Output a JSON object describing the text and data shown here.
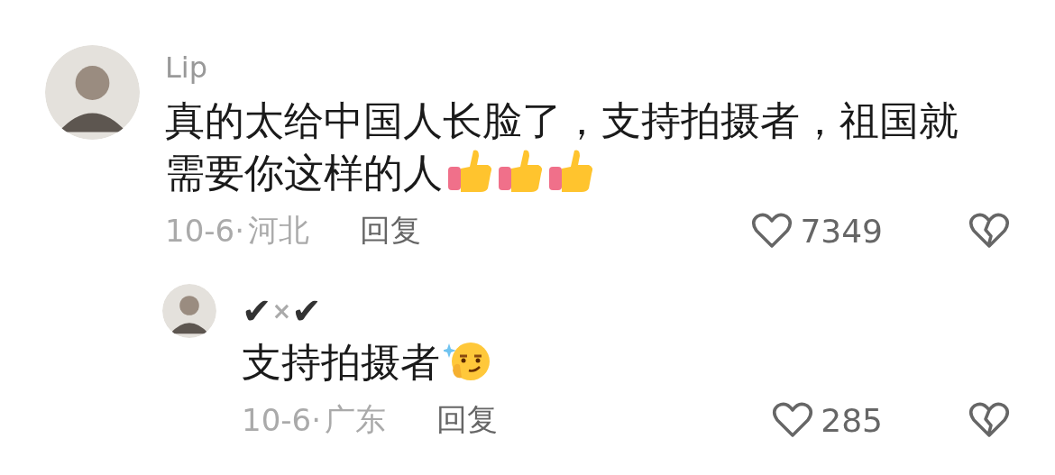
{
  "comments": [
    {
      "author_parts": [
        {
          "text": "Lip",
          "muted": false
        }
      ],
      "text_lines": [
        "真的太给中国人长脸了，支持拍摄者，祖国就",
        "需要你这样的人"
      ],
      "emoji": [
        {
          "kind": "thumbs-up"
        },
        {
          "kind": "thumbs-up"
        },
        {
          "kind": "thumbs-up"
        }
      ],
      "date": "10-6·",
      "location": "河北",
      "reply_label": "回复",
      "likes": "7349",
      "replies": [
        {
          "author_parts": [
            {
              "text": "✔",
              "muted": false
            },
            {
              "text": "×",
              "muted": true
            },
            {
              "text": "✔",
              "muted": false
            }
          ],
          "text_lines": [
            "支持拍摄者"
          ],
          "emoji": [
            {
              "kind": "smirk"
            }
          ],
          "date": "10-6·",
          "location": "广东",
          "reply_label": "回复",
          "likes": "285"
        }
      ]
    }
  ]
}
